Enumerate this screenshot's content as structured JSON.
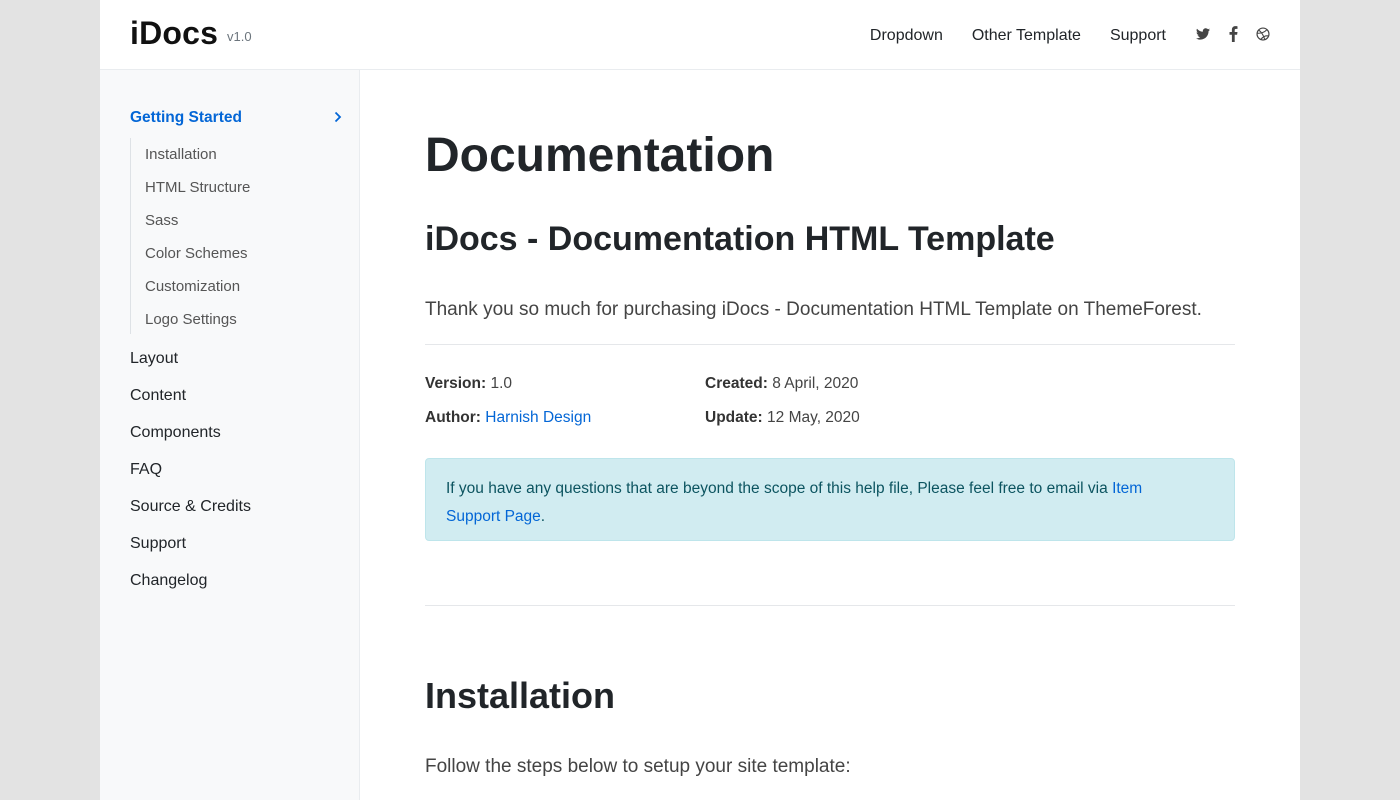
{
  "brand": {
    "name": "iDocs",
    "version": "v1.0"
  },
  "topnav": {
    "items": [
      "Dropdown",
      "Other Template",
      "Support"
    ]
  },
  "social": {
    "icons": [
      "twitter-icon",
      "facebook-icon",
      "dribbble-icon"
    ]
  },
  "sidebar": {
    "active": "Getting Started",
    "subitems": [
      "Installation",
      "HTML Structure",
      "Sass",
      "Color Schemes",
      "Customization",
      "Logo Settings"
    ],
    "items": [
      "Layout",
      "Content",
      "Components",
      "FAQ",
      "Source & Credits",
      "Support",
      "Changelog"
    ]
  },
  "main": {
    "title": "Documentation",
    "subtitle": "iDocs - Documentation HTML Template",
    "lead": "Thank you so much for purchasing iDocs - Documentation HTML Template on ThemeForest.",
    "meta": {
      "version_label": "Version:",
      "version_value": "1.0",
      "author_label": "Author:",
      "author_value": "Harnish Design",
      "created_label": "Created:",
      "created_value": "8 April, 2020",
      "update_label": "Update:",
      "update_value": "12 May, 2020"
    },
    "alert": {
      "text": "If you have any questions that are beyond the scope of this help file, Please feel free to email via",
      "link_line1": "Item",
      "link_line2": "Support Page",
      "end": "."
    },
    "section_title": "Installation",
    "section_text": "Follow the steps below to setup your site template:"
  },
  "colors": {
    "accent": "#0366d6",
    "alert_bg": "#d1ecf1",
    "alert_text": "#0c5460",
    "sidebar_bg": "#f8f9fa"
  }
}
